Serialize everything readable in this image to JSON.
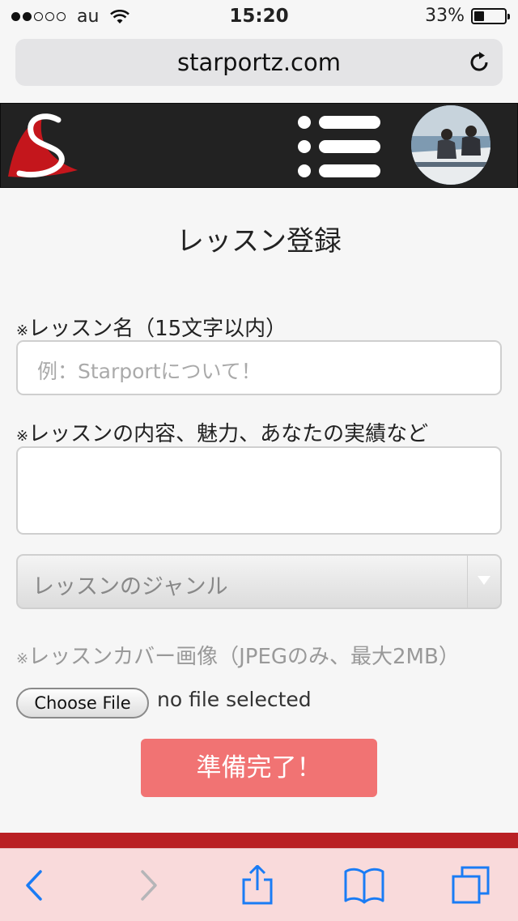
{
  "status_bar": {
    "carrier": "au",
    "time": "15:20",
    "battery_percent": "33%",
    "battery_level": 0.33,
    "signal_bars_filled": 2
  },
  "browser": {
    "url": "starportz.com"
  },
  "page": {
    "title": "レッスン登録"
  },
  "form": {
    "lesson_name": {
      "mark": "※",
      "label": "レッスン名（15文字以内）",
      "placeholder": "例：Starportについて！"
    },
    "lesson_content": {
      "mark": "※",
      "label": "レッスンの内容、魅力、あなたの実績など"
    },
    "genre": {
      "selected": "レッスンのジャンル"
    },
    "cover": {
      "mark": "※",
      "label": "レッスンカバー画像（JPEGのみ、最大2MB）",
      "button": "Choose File",
      "status": "no file selected"
    },
    "submit": "準備完了！"
  },
  "colors": {
    "accent_red": "#b92024",
    "submit_button": "#f17373",
    "toolbar_icon": "#1a7cf5"
  },
  "toolbar_icons": [
    "back-icon",
    "forward-icon",
    "share-icon",
    "bookmarks-icon",
    "tabs-icon"
  ]
}
